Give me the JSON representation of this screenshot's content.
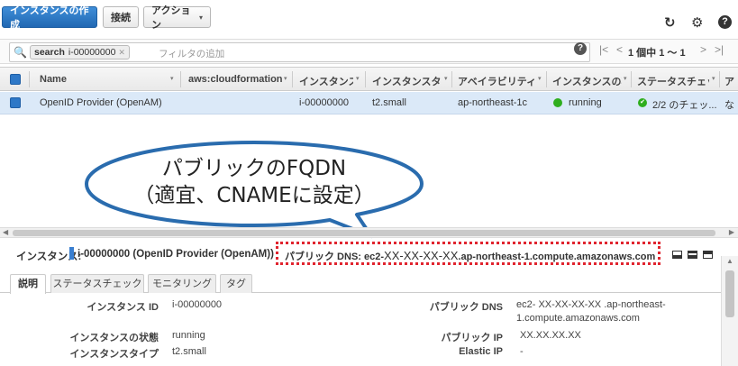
{
  "toolbar": {
    "create_label": "インスタンスの作成",
    "connect_label": "接続",
    "action_label": "アクション",
    "caret": "▾",
    "refresh_icon": "↻",
    "gear_icon": "⚙",
    "help_icon": "?"
  },
  "search": {
    "chip_key": "search",
    "chip_value": "i-00000000",
    "chip_clear": "✕",
    "placeholder": "フィルタの追加",
    "help_icon": "?",
    "pager": {
      "first": "|<",
      "prev": "<",
      "text": "1 個中 1 ～ 1",
      "next": ">",
      "last": ">|"
    }
  },
  "table": {
    "headers": [
      "Name",
      "aws:cloudformation:s",
      "インスタンス ID",
      "インスタンスタイプ",
      "アベイラビリティーゾーン",
      "インスタンスの状態",
      "ステータスチェック",
      "ア"
    ],
    "header_caret": "▾",
    "rows": [
      {
        "name": "OpenID Provider (OpenAM)",
        "cfn": "",
        "instance_id": "i-00000000",
        "type": "t2.small",
        "az": "ap-northeast-1c",
        "state": "running",
        "status": "2/2 のチェッ...",
        "more": "な"
      }
    ],
    "status_check_glyph": "✔"
  },
  "annotation": {
    "line1": "パブリックのFQDN",
    "line2": "（適宜、CNAMEに設定）"
  },
  "hscroll": {
    "left": "◀",
    "right": "▶"
  },
  "detail": {
    "instance_label": "インスタンス:",
    "instance_value": "i-00000000 (OpenID Provider (OpenAM))",
    "dns_label": "パブリック DNS:",
    "dns_prefix": "ec2-",
    "dns_xx": "XX-XX-XX-XX",
    "dns_suffix": ".ap-northeast-1.compute.amazonaws.com",
    "tabs": [
      "説明",
      "ステータスチェック",
      "モニタリング",
      "タグ"
    ],
    "fields_left": [
      {
        "key": "インスタンス ID",
        "value": "i-00000000"
      },
      {
        "key": "インスタンスの状態",
        "value": "running"
      },
      {
        "key": "インスタンスタイプ",
        "value": "t2.small"
      }
    ],
    "fields_right": [
      {
        "key": "パブリック DNS",
        "value_line1": "ec2- XX-XX-XX-XX .ap-northeast-",
        "value_line2": "1.compute.amazonaws.com"
      },
      {
        "key": "パブリック IP",
        "value": "XX.XX.XX.XX"
      },
      {
        "key": "Elastic IP",
        "value": "-"
      }
    ]
  },
  "vscroll": {
    "up": "▲"
  },
  "colors": {
    "primary": "#2e78c7",
    "selected_row": "#dbe9f8",
    "running": "#2fae1e",
    "callout_border": "#2a6cae",
    "dns_highlight": "#e0242e"
  }
}
